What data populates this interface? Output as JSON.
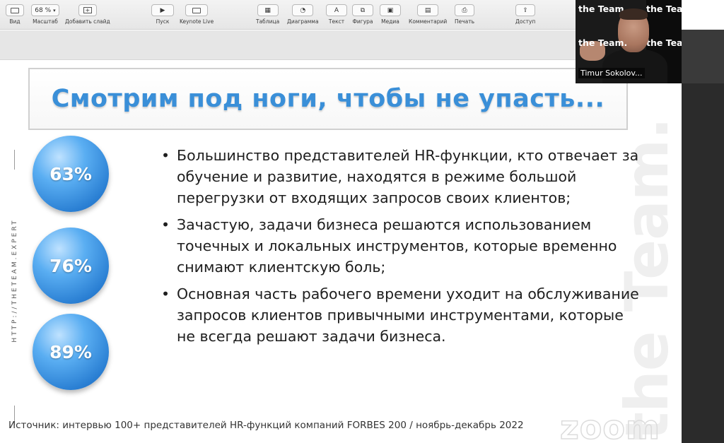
{
  "toolbar": {
    "view_label": "Вид",
    "zoom_value": "68 %",
    "zoom_label": "Масштаб",
    "add_slide_label": "Добавить слайд",
    "play_label": "Пуск",
    "keynote_live_label": "Keynote Live",
    "table_label": "Таблица",
    "chart_label": "Диаграмма",
    "text_label": "Текст",
    "shape_label": "Фигура",
    "media_label": "Медиа",
    "comment_label": "Комментарий",
    "print_label": "Печать",
    "share_label": "Доступ"
  },
  "slide": {
    "title": "Смотрим под ноги, чтобы не упасть...",
    "stats": [
      {
        "value": "63%"
      },
      {
        "value": "76%"
      },
      {
        "value": "89%"
      }
    ],
    "bullets": [
      "Большинство представителей HR-функции, кто отвечает за обучение и развитие, находятся в режиме большой перегрузки от входящих запросов своих клиентов;",
      "Зачастую, задачи бизнеса решаются использованием точечных и локальных инструментов, которые временно снимают клиентскую боль;",
      "Основная часть рабочего времени уходит на обслуживание запросов клиентов привычными инструментами, которые не всегда решают задачи бизнеса."
    ],
    "vertical_url": "HTTP://THETEAM.EXPERT",
    "brand_vertical": "the Team.",
    "source": "Источник: интервью 100+ представителей HR-функций компаний FORBES 200 / ноябрь-декабрь 2022",
    "watermark": "zoom"
  },
  "video": {
    "participant_name": "Timur Sokolov...",
    "brand_text": "the Team."
  },
  "colors": {
    "title_blue": "#3a8fd8",
    "circle_blue": "#2a7fd3",
    "toolbar_bg": "#ececec"
  }
}
